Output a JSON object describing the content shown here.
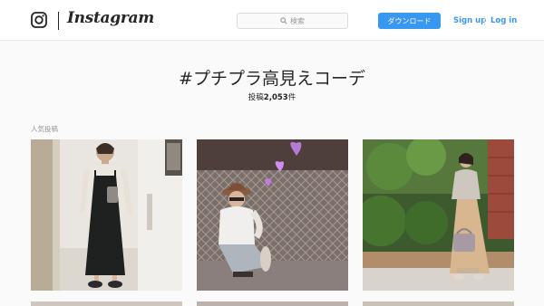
{
  "header": {
    "brand_wordmark": "Instagram",
    "search_placeholder": "検索",
    "download_label": "ダウンロード",
    "signup_label": "Sign up",
    "login_label": "Log in",
    "accent_color": "#3897f0"
  },
  "hashtag": {
    "title": "#プチプラ高見えコーデ",
    "posts_prefix": "投稿",
    "posts_count": "2,053",
    "posts_suffix": "件"
  },
  "section": {
    "label": "人気投稿"
  },
  "posts": [
    {
      "icon": "photo-mirror-selfie"
    },
    {
      "icon": "photo-hat-fence-hearts"
    },
    {
      "icon": "photo-garden-outfit"
    }
  ]
}
